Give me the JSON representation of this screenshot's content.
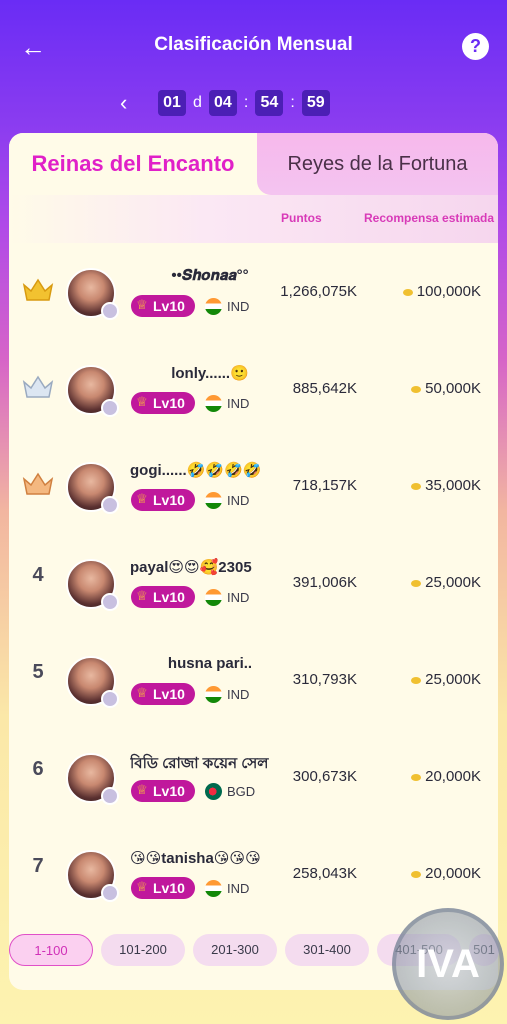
{
  "header": {
    "title": "Clasificación Mensual"
  },
  "countdown": {
    "days": "01",
    "day_unit": "d",
    "hours": "04",
    "sep1": ":",
    "minutes": "54",
    "sep2": ":",
    "seconds": "59"
  },
  "tabs": [
    {
      "label": "Reinas del Encanto"
    },
    {
      "label": "Reyes de la Fortuna"
    }
  ],
  "columns": {
    "points": "Puntos",
    "reward": "Recompensa estimada"
  },
  "rows": [
    {
      "rank": "",
      "crown": "gold-crown-icon",
      "name": "••𝑺𝒉𝒐𝒏𝒂𝒂°°",
      "level": "Lv10",
      "country": "IND",
      "points": "1,266,075K",
      "reward": "100,000K"
    },
    {
      "rank": "",
      "crown": "silver-crown-icon",
      "name": "lonly......🙂",
      "level": "Lv10",
      "country": "IND",
      "points": "885,642K",
      "reward": "50,000K"
    },
    {
      "rank": "",
      "crown": "bronze-crown-icon",
      "name": "gogi......🤣🤣🤣🤣",
      "level": "Lv10",
      "country": "IND",
      "points": "718,157K",
      "reward": "35,000K"
    },
    {
      "rank": "4",
      "name": "payal😍😍🥰2305",
      "level": "Lv10",
      "country": "IND",
      "points": "391,006K",
      "reward": "25,000K"
    },
    {
      "rank": "5",
      "name": "husna pari..",
      "level": "Lv10",
      "country": "IND",
      "points": "310,793K",
      "reward": "25,000K"
    },
    {
      "rank": "6",
      "name": "বিডি রোজা কয়েন সেল",
      "level": "Lv10",
      "country": "BGD",
      "points": "300,673K",
      "reward": "20,000K"
    },
    {
      "rank": "7",
      "name": "😘😘tanisha😘😘😘",
      "level": "Lv10",
      "country": "IND",
      "points": "258,043K",
      "reward": "20,000K"
    }
  ],
  "pages": [
    "1-100",
    "101-200",
    "201-300",
    "301-400",
    "401-500",
    "501"
  ],
  "watermark": "IVA",
  "colors": {
    "accent": "#e020c8",
    "level_badge": "#c0189c",
    "header_top": "#6a2cf5"
  }
}
